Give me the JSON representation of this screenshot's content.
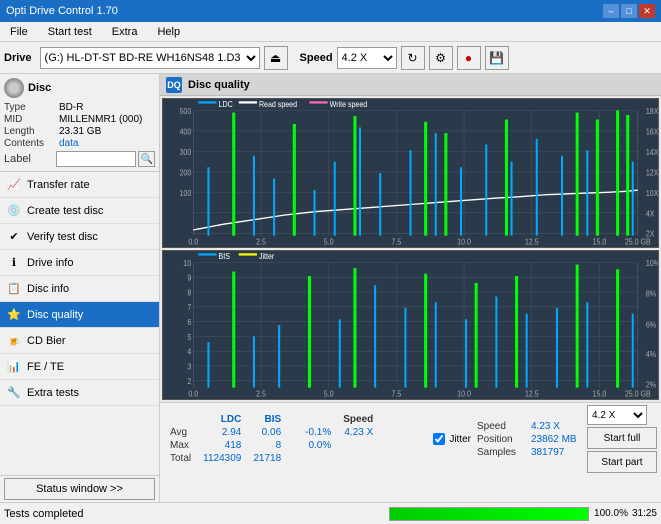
{
  "titleBar": {
    "title": "Opti Drive Control 1.70",
    "minimize": "–",
    "maximize": "□",
    "close": "✕"
  },
  "menuBar": {
    "items": [
      "File",
      "Start test",
      "Extra",
      "Help"
    ]
  },
  "toolbar": {
    "driveLabel": "Drive",
    "driveValue": "(G:)  HL-DT-ST BD-RE  WH16NS48 1.D3",
    "speedLabel": "Speed",
    "speedValue": "4.2 X"
  },
  "sidebar": {
    "discSection": {
      "label": "Disc",
      "fields": [
        {
          "key": "Type",
          "val": "BD-R",
          "blue": false
        },
        {
          "key": "MID",
          "val": "MILLENMR1 (000)",
          "blue": false
        },
        {
          "key": "Length",
          "val": "23.31 GB",
          "blue": false
        },
        {
          "key": "Contents",
          "val": "data",
          "blue": true
        }
      ],
      "labelField": {
        "placeholder": "",
        "btnIcon": "🔍"
      }
    },
    "navItems": [
      {
        "id": "transfer-rate",
        "label": "Transfer rate",
        "icon": "📈",
        "active": false
      },
      {
        "id": "create-test-disc",
        "label": "Create test disc",
        "icon": "💿",
        "active": false
      },
      {
        "id": "verify-test-disc",
        "label": "Verify test disc",
        "icon": "✔",
        "active": false
      },
      {
        "id": "drive-info",
        "label": "Drive info",
        "icon": "ℹ",
        "active": false
      },
      {
        "id": "disc-info",
        "label": "Disc info",
        "icon": "📋",
        "active": false
      },
      {
        "id": "disc-quality",
        "label": "Disc quality",
        "icon": "⭐",
        "active": true
      },
      {
        "id": "cd-bier",
        "label": "CD Bier",
        "icon": "🍺",
        "active": false
      },
      {
        "id": "fe-te",
        "label": "FE / TE",
        "icon": "📊",
        "active": false
      },
      {
        "id": "extra-tests",
        "label": "Extra tests",
        "icon": "🔧",
        "active": false
      }
    ],
    "statusBtn": "Status window >>"
  },
  "discQuality": {
    "title": "Disc quality",
    "chart1": {
      "legend": [
        {
          "label": "LDC",
          "color": "#00aaff"
        },
        {
          "label": "Read speed",
          "color": "#ffffff"
        },
        {
          "label": "Write speed",
          "color": "#ff69b4"
        }
      ],
      "yAxisMax": 500,
      "yAxisRight": "18X",
      "xAxisMax": "25.0 GB"
    },
    "chart2": {
      "legend": [
        {
          "label": "BIS",
          "color": "#00aaff"
        },
        {
          "label": "Jitter",
          "color": "#ffff00"
        }
      ],
      "yAxisMax": 10,
      "xAxisMax": "25.0 GB"
    },
    "stats": {
      "columns": [
        "",
        "LDC",
        "BIS",
        "",
        "Jitter",
        "Speed",
        ""
      ],
      "rows": [
        {
          "label": "Avg",
          "ldc": "2.94",
          "bis": "0.06",
          "jitter": "-0.1%",
          "speed": "4.23 X"
        },
        {
          "label": "Max",
          "ldc": "418",
          "bis": "8",
          "jitter": "0.0%",
          "position": "23862 MB"
        },
        {
          "label": "Total",
          "ldc": "1124309",
          "bis": "21718",
          "samples": "381797"
        }
      ],
      "positionLabel": "Position",
      "samplesLabel": "Samples",
      "speedSelectVal": "4.2 X",
      "startFull": "Start full",
      "startPart": "Start part",
      "jitterChecked": true,
      "jitterLabel": "Jitter"
    }
  },
  "bottomBar": {
    "statusText": "Tests completed",
    "progressPercent": 100,
    "progressLabel": "100.0%",
    "timeLabel": "31:25"
  }
}
